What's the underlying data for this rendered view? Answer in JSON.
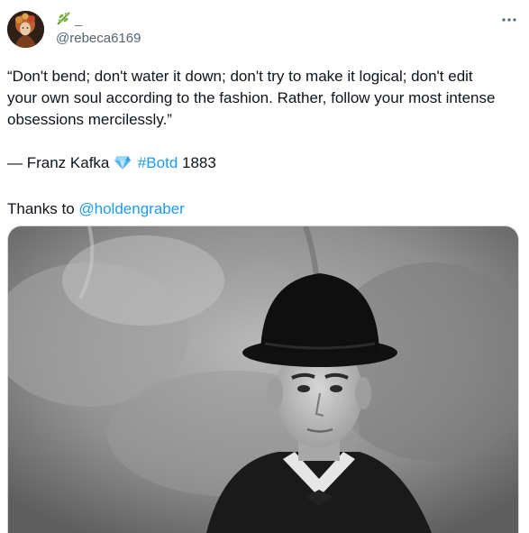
{
  "author": {
    "display_name": "_",
    "handle": "@rebeca6169",
    "avatar_icon": "avatar-painting-icon",
    "name_emoji_icon": "herb-sprig-icon"
  },
  "more_icon": "more-horizontal-icon",
  "tweet": {
    "line1": "“Don't bend; don't water it down; don't try to make it logical; don't edit",
    "line2": "your own soul according to the fashion. Rather, follow your most intense",
    "line3": "obsessions mercilessly.”",
    "attribution_prefix": "— Franz Kafka",
    "gem_icon": "gem-stone-icon",
    "hashtag": "#Botd",
    "year": "1883",
    "thanks_prefix": "Thanks to",
    "mention": "@holdengraber"
  },
  "media": {
    "image_icon": "portrait-photo-image"
  }
}
